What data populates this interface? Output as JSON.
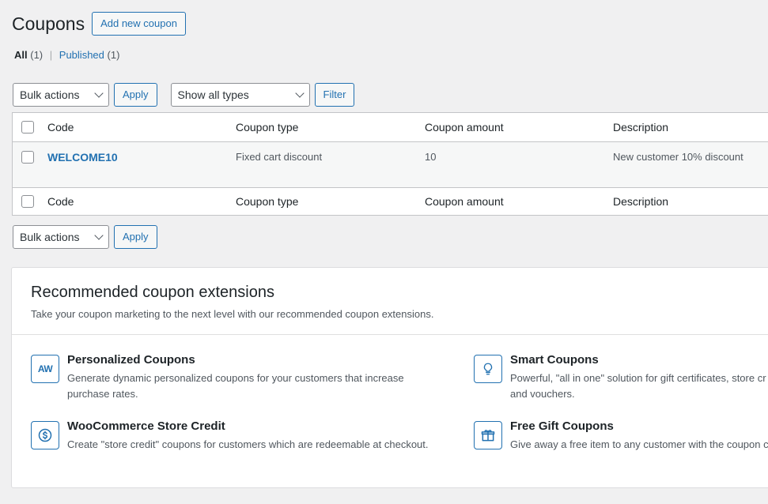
{
  "header": {
    "title": "Coupons",
    "add_button": "Add new coupon"
  },
  "filters": {
    "all_label": "All",
    "all_count": "(1)",
    "separator": "|",
    "published_label": "Published",
    "published_count": "(1)"
  },
  "tablenav": {
    "bulk_actions": "Bulk actions",
    "apply": "Apply",
    "type_filter": "Show all types",
    "filter_button": "Filter"
  },
  "table": {
    "columns": [
      "Code",
      "Coupon type",
      "Coupon amount",
      "Description"
    ],
    "rows": [
      {
        "code": "WELCOME10",
        "type": "Fixed cart discount",
        "amount": "10",
        "description": "New customer 10% discount"
      }
    ]
  },
  "recommended": {
    "title": "Recommended coupon extensions",
    "subtitle": "Take your coupon marketing to the next level with our recommended coupon extensions.",
    "extensions": [
      {
        "name": "Personalized Coupons",
        "desc1": "Generate dynamic personalized coupons for your customers that increase",
        "desc2": "purchase rates.",
        "icon": "aw-logo-icon",
        "icon_text": "AW"
      },
      {
        "name": "Smart Coupons",
        "desc1": "Powerful, \"all in one\" solution for gift certificates, store cr",
        "desc2": "and vouchers.",
        "icon": "lightbulb-icon"
      },
      {
        "name": "WooCommerce Store Credit",
        "desc1": "Create \"store credit\" coupons for customers which are redeemable at checkout.",
        "desc2": "",
        "icon": "dollar-circle-icon"
      },
      {
        "name": "Free Gift Coupons",
        "desc1": "Give away a free item to any customer with the coupon c",
        "desc2": "",
        "icon": "gift-icon"
      }
    ]
  },
  "colors": {
    "accent": "#2271b1",
    "background": "#f0f0f1",
    "text": "#1d2327"
  }
}
